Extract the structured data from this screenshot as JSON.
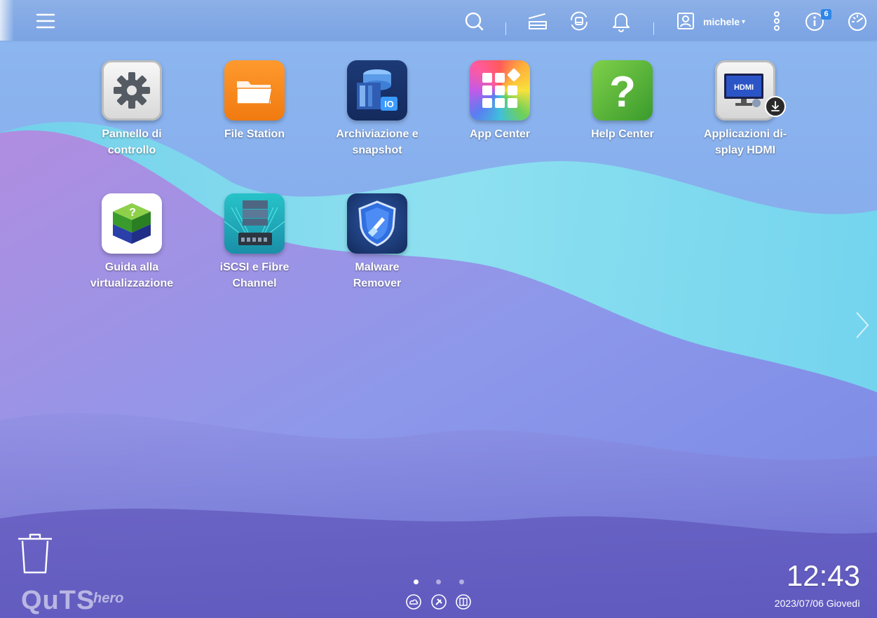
{
  "topbar": {
    "menu_icon": "hamburger-menu-icon",
    "search_icon": "search-icon",
    "tasks_icon": "background-tasks-icon",
    "external_device_icon": "external-device-icon",
    "notification_icon": "bell-icon",
    "user": {
      "name": "michele",
      "icon": "user-icon",
      "caret": "▾"
    },
    "more_icon": "vertical-ellipsis-icon",
    "info": {
      "icon": "info-icon",
      "badge": "6"
    },
    "dashboard_icon": "dashboard-gauge-icon"
  },
  "apps": [
    {
      "line1": "Pannello di",
      "line2": "controllo",
      "icon": "gear-icon"
    },
    {
      "line1": "File Station",
      "line2": "",
      "icon": "folder-icon"
    },
    {
      "line1": "Archiviazione e",
      "line2": "snapshot",
      "icon": "storage-snapshot-icon"
    },
    {
      "line1": "App Center",
      "line2": "",
      "icon": "app-grid-icon"
    },
    {
      "line1": "Help Center",
      "line2": "",
      "icon": "question-mark-icon"
    },
    {
      "line1": "Applicazioni di-",
      "line2": "splay HDMI",
      "icon": "hdmi-monitor-icon",
      "overlay": "HDMI"
    },
    {
      "line1": "Guida alla",
      "line2": "virtualizzazione",
      "icon": "virtualization-cube-icon"
    },
    {
      "line1": "iSCSI e Fibre",
      "line2": "Channel",
      "icon": "iscsi-server-icon"
    },
    {
      "line1": "Malware",
      "line2": "Remover",
      "icon": "shield-broom-icon"
    }
  ],
  "desktop": {
    "trash_icon": "trash-icon",
    "brand": "QuTS",
    "brand_sup": "hero",
    "page_dots": [
      "active",
      "inactive",
      "inactive"
    ],
    "bottom_icons": [
      "cloud-icon",
      "tools-icon",
      "book-icon"
    ],
    "next_page_icon": "chevron-right-icon"
  },
  "clock": {
    "time": "12:43",
    "date": "2023/07/06 Giovedì"
  },
  "colors": {
    "accent": "#2f86e8",
    "folder_orange": "#f7861c",
    "help_green": "#57b83a",
    "storage_navy": "#1e3f7d"
  }
}
